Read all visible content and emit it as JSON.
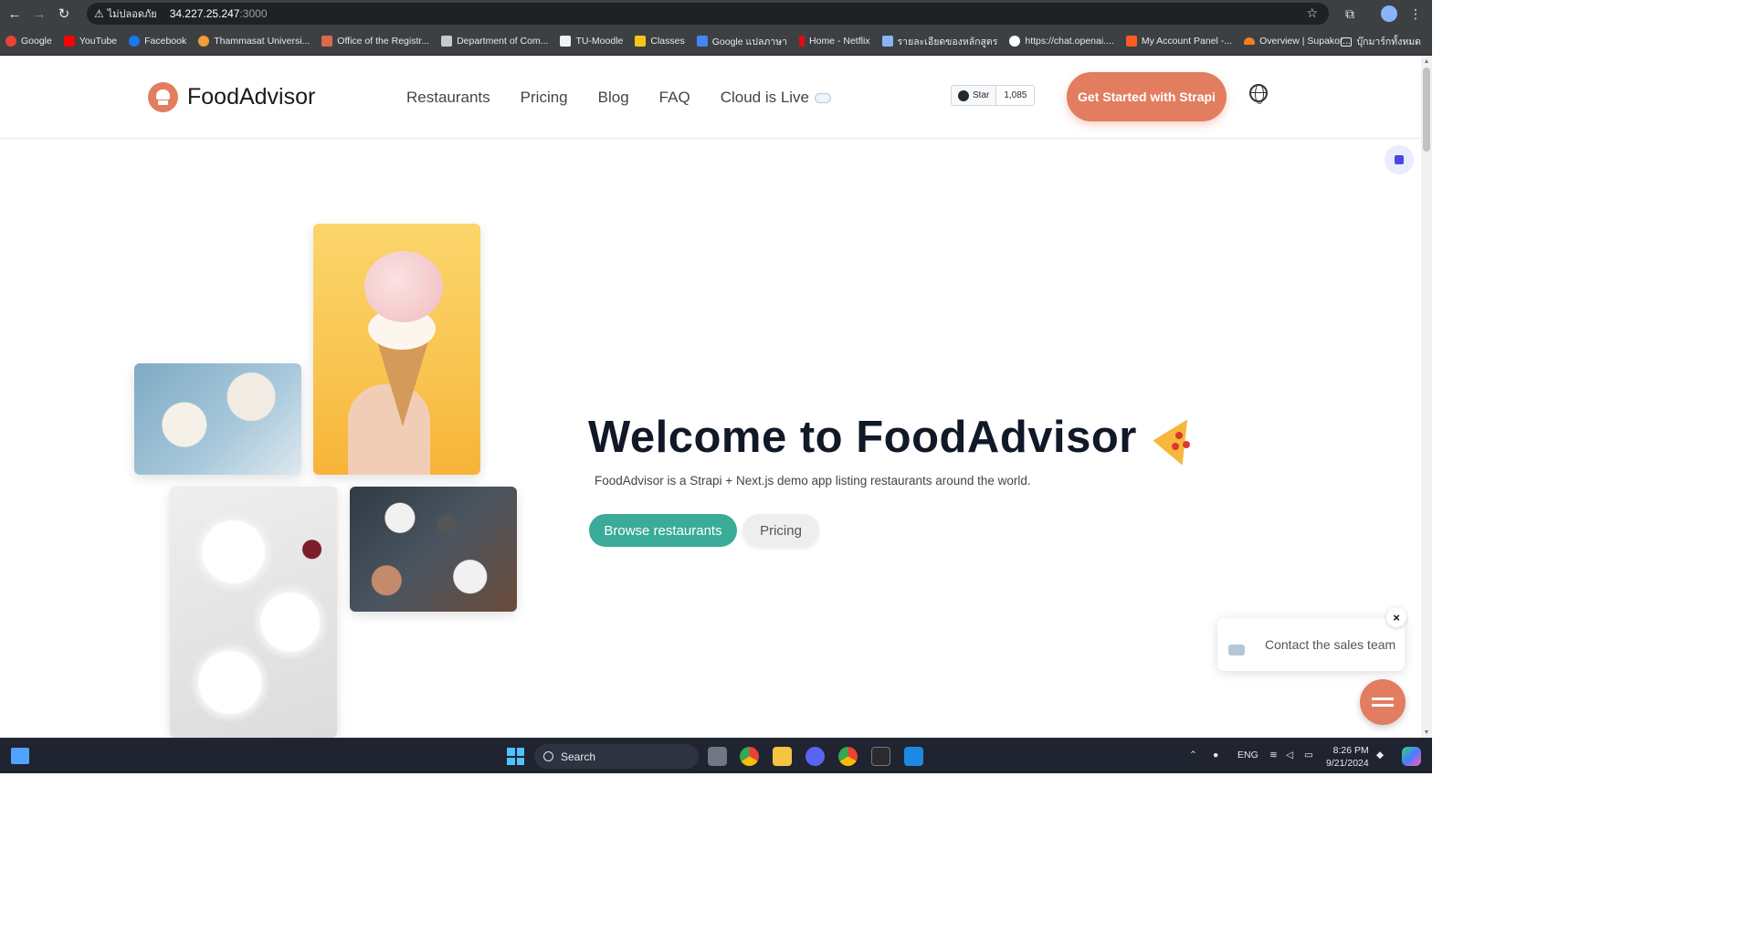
{
  "browser": {
    "security_label": "ไม่ปลอดภัย",
    "url_host": "34.227.25.247",
    "url_port": ":3000",
    "bookmarks": [
      {
        "label": "Google",
        "color": "#ea4335"
      },
      {
        "label": "YouTube",
        "color": "#ff0000"
      },
      {
        "label": "Facebook",
        "color": "#1877f2"
      },
      {
        "label": "Thammasat Universi...",
        "color": "#f29d38"
      },
      {
        "label": "Office of the Registr...",
        "color": "#d96a4a"
      },
      {
        "label": "Department of Com...",
        "color": "#c9c9c9"
      },
      {
        "label": "TU-Moodle",
        "color": "#f1f1f1"
      },
      {
        "label": "Classes",
        "color": "#f5c518"
      },
      {
        "label": "Google แปลภาษา",
        "color": "#4285f4"
      },
      {
        "label": "Home - Netflix",
        "color": "#e50914"
      },
      {
        "label": "รายละเอียดของหลักสูตร",
        "color": "#8ab4f8"
      },
      {
        "label": "https://chat.openai....",
        "color": "#ffffff"
      },
      {
        "label": "My Account Panel -...",
        "color": "#ff5a1f"
      },
      {
        "label": "Overview | Supakor...",
        "color": "#f38020"
      }
    ],
    "all_bookmarks_label": "บุ๊กมาร์กทั้งหมด"
  },
  "site": {
    "logo_text": "FoodAdvisor",
    "nav": [
      "Restaurants",
      "Pricing",
      "Blog",
      "FAQ",
      "Cloud is Live"
    ],
    "github_star_label": "Star",
    "github_star_count": "1,085",
    "cta_label": "Get Started with Strapi"
  },
  "hero": {
    "title": "Welcome to FoodAdvisor",
    "subtitle": "FoodAdvisor is a Strapi + Next.js demo app listing restaurants around the world.",
    "primary_button": "Browse restaurants",
    "secondary_button": "Pricing"
  },
  "chat": {
    "popup_text": "Contact the sales team",
    "close_symbol": "×"
  },
  "taskbar": {
    "search_label": "Search",
    "language": "ENG",
    "time": "8:26 PM",
    "date": "9/21/2024"
  },
  "colors": {
    "accent": "#e27d60",
    "primary_button": "#3aab98",
    "heading": "#111827"
  }
}
